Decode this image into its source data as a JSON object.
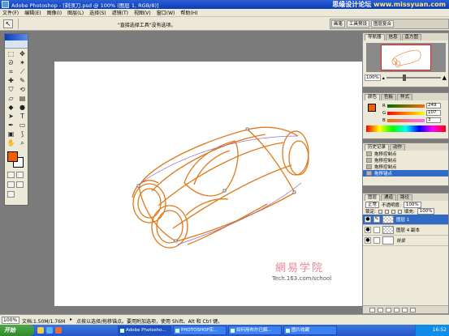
{
  "window": {
    "title": "Adobe Photoshop - [剃须刀.psd @ 100% (图层 1, RGB/8)]",
    "watermark": "思缘设计论坛",
    "watermark_tail": "www.missyuan.com"
  },
  "menu": [
    "文件(F)",
    "编辑(E)",
    "图像(I)",
    "图层(L)",
    "选择(S)",
    "滤镜(T)",
    "视图(V)",
    "窗口(W)",
    "帮助(H)"
  ],
  "options": {
    "hint": "\"直接选择工具\"没有选项。",
    "wells": [
      "画笔",
      "工具预设",
      "图层复合"
    ]
  },
  "navigator": {
    "tabs": [
      "导航器",
      "信息",
      "直方图"
    ],
    "zoom": "100%"
  },
  "color_panel": {
    "tabs": [
      "颜色",
      "色板",
      "样式"
    ],
    "rows": [
      {
        "label": "R",
        "value": "249"
      },
      {
        "label": "G",
        "value": "107"
      },
      {
        "label": "B",
        "value": "3"
      }
    ],
    "foreground": "#f96b03"
  },
  "history_panel": {
    "tabs": [
      "历史记录",
      "动作"
    ],
    "items": [
      "拖移控制点",
      "拖移控制点",
      "拖移控制点",
      "拖移锚点"
    ]
  },
  "layers_panel": {
    "tabs": [
      "图层",
      "通道",
      "路径"
    ],
    "blend_mode": "正常",
    "opacity_label": "不透明度:",
    "opacity": "100%",
    "lock_label": "锁定:",
    "fill_label": "填充:",
    "fill": "100%",
    "layers": [
      "图层 1",
      "图层 4 副本",
      "背景"
    ]
  },
  "canvas": {
    "brand_text": "網易学院",
    "brand_url": "Tech.163.com/school",
    "stroke_color": "#e07a1a"
  },
  "status": {
    "zoom": "100%",
    "doc_size": "文档:1.50M/1.76M",
    "message": "点按以选择/拖移锚点。要用附加选项，使用 Shift、Alt 和 Ctrl 键。"
  },
  "taskbar": {
    "start": "开始",
    "tasks": [
      "Adobe Photosho...",
      "PHOTOSHOP实...",
      "如何用布尔已解...",
      "图片收藏"
    ],
    "clock": "16:52"
  }
}
